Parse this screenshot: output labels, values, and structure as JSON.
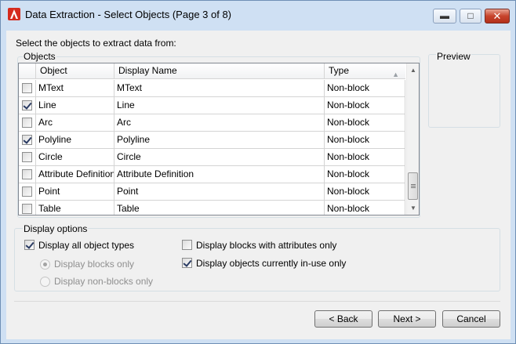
{
  "window": {
    "title": "Data Extraction - Select Objects (Page 3 of 8)",
    "controls": {
      "minimize": "▬",
      "maximize": "□",
      "close": "✕"
    }
  },
  "instruction": "Select the objects to extract data from:",
  "objects": {
    "label": "Objects",
    "columns": {
      "checkbox": "",
      "object": "Object",
      "display_name": "Display Name",
      "type": "Type"
    },
    "rows": [
      {
        "checked": false,
        "object": "MText",
        "display_name": "MText",
        "type": "Non-block"
      },
      {
        "checked": true,
        "object": "Line",
        "display_name": "Line",
        "type": "Non-block"
      },
      {
        "checked": false,
        "object": "Arc",
        "display_name": "Arc",
        "type": "Non-block"
      },
      {
        "checked": true,
        "object": "Polyline",
        "display_name": "Polyline",
        "type": "Non-block"
      },
      {
        "checked": false,
        "object": "Circle",
        "display_name": "Circle",
        "type": "Non-block"
      },
      {
        "checked": false,
        "object": "Attribute Definition",
        "display_name": "Attribute Definition",
        "type": "Non-block"
      },
      {
        "checked": false,
        "object": "Point",
        "display_name": "Point",
        "type": "Non-block"
      },
      {
        "checked": false,
        "object": "Table",
        "display_name": "Table",
        "type": "Non-block"
      }
    ]
  },
  "preview": {
    "label": "Preview"
  },
  "display_options": {
    "label": "Display options",
    "all_object_types": {
      "label": "Display all object types",
      "checked": true
    },
    "blocks_only": {
      "label": "Display blocks only",
      "selected": true,
      "enabled": false
    },
    "non_blocks_only": {
      "label": "Display non-blocks only",
      "selected": false,
      "enabled": false
    },
    "blocks_with_attributes": {
      "label": "Display blocks with attributes only",
      "checked": false
    },
    "objects_in_use": {
      "label": "Display objects currently in-use only",
      "checked": true
    }
  },
  "buttons": {
    "back": "< Back",
    "next": "Next >",
    "cancel": "Cancel"
  },
  "colors": {
    "title_bar": "#cfe0f3",
    "close_button": "#c7432c",
    "app_icon": "#d52b1e"
  }
}
